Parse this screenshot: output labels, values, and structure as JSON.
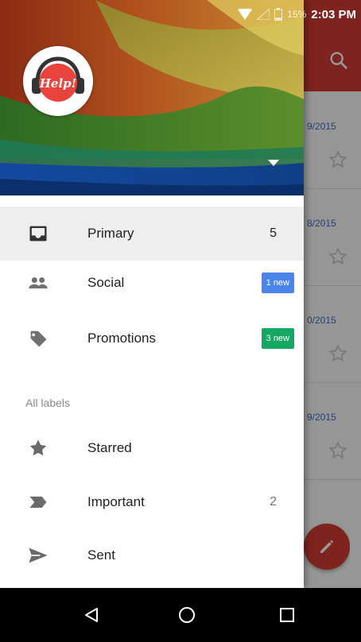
{
  "status_bar": {
    "battery_percent": "15%",
    "time": "2:03 PM"
  },
  "background": {
    "dates": [
      "9/2015",
      "8/2015",
      "0/2015",
      "9/2015"
    ],
    "colors": {
      "appbar": "#d23b33",
      "date": "#3b6fd0"
    }
  },
  "drawer": {
    "avatar_text": "Help!",
    "primary_items": [
      {
        "label": "Primary",
        "count": "5",
        "icon": "inbox-icon",
        "active": true
      },
      {
        "label": "Social",
        "badge": "1 new",
        "badge_color": "#4a86e8",
        "icon": "people-icon"
      },
      {
        "label": "Promotions",
        "badge": "3 new",
        "badge_color": "#16a765",
        "icon": "tag-icon"
      }
    ],
    "section_label": "All labels",
    "label_items": [
      {
        "label": "Starred",
        "icon": "star-icon"
      },
      {
        "label": "Important",
        "count": "2",
        "icon": "important-icon"
      },
      {
        "label": "Sent",
        "icon": "send-icon"
      }
    ]
  },
  "system_nav": {
    "icons": [
      "back-icon",
      "home-icon",
      "recents-icon"
    ]
  }
}
